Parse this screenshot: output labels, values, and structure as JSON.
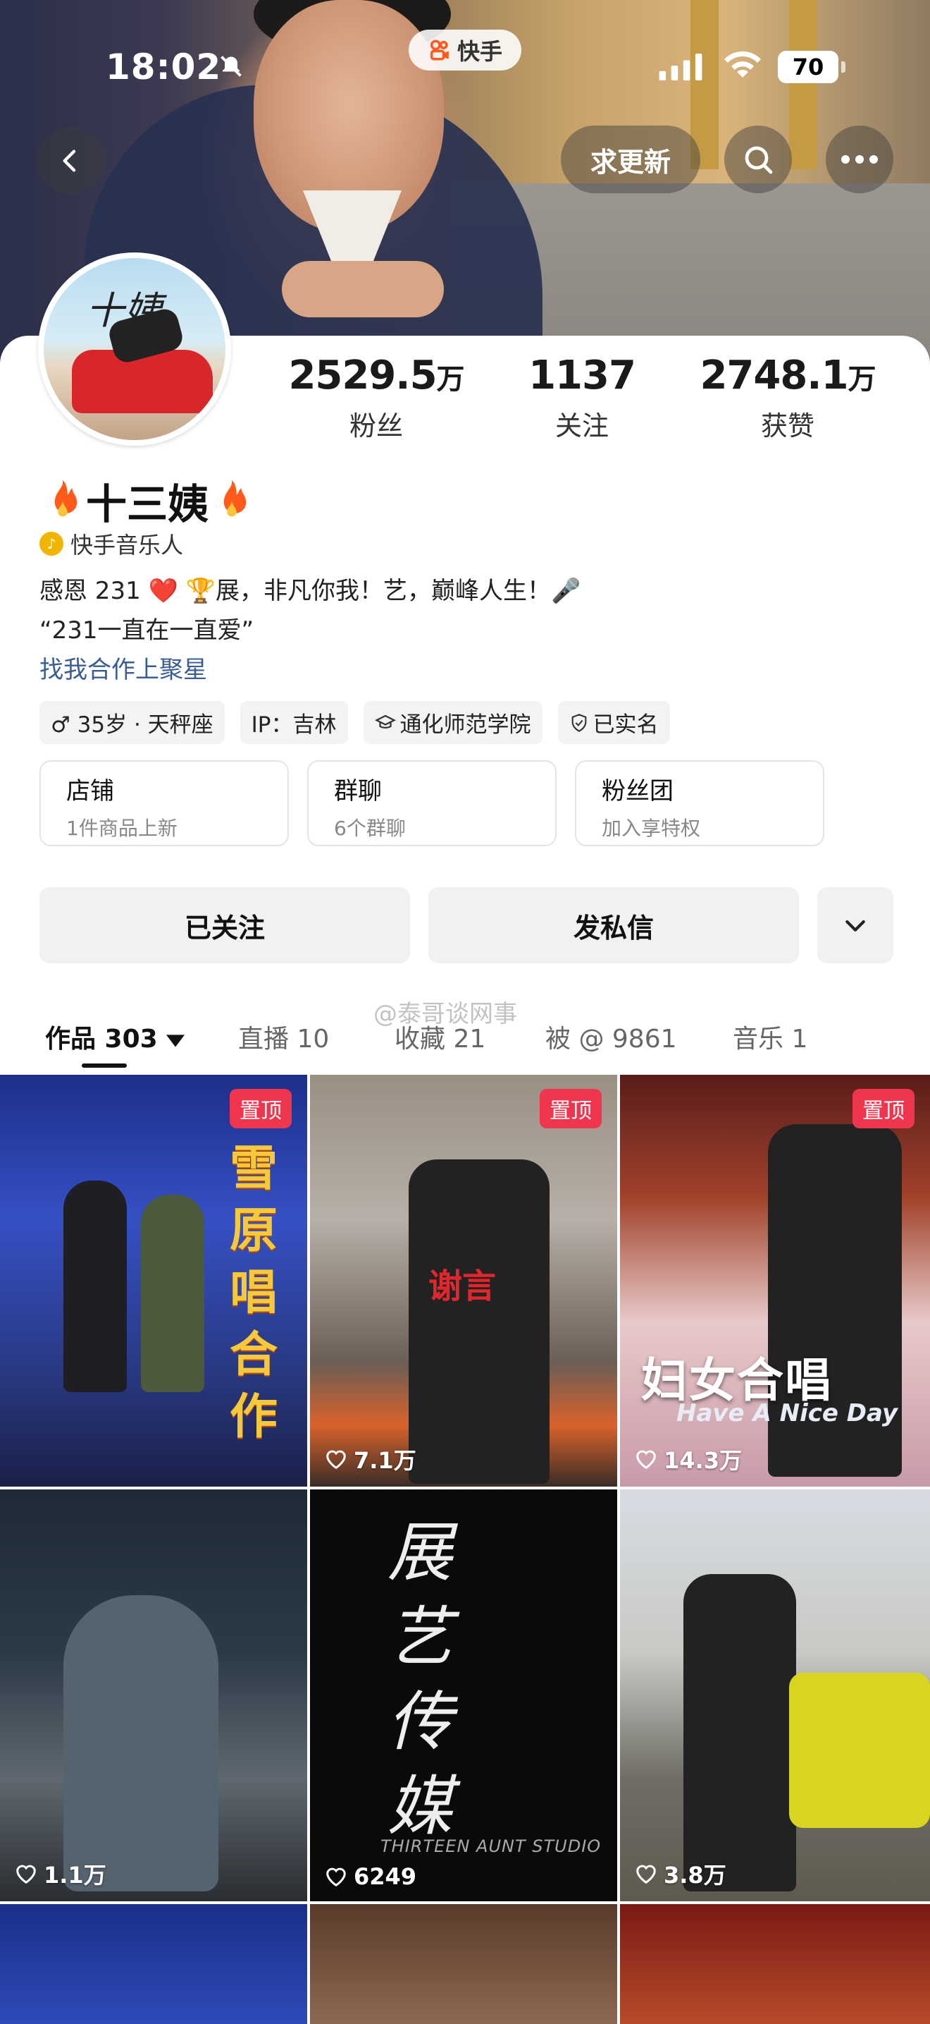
{
  "status_bar": {
    "time": "18:02",
    "app_pill": "快手",
    "battery": "70"
  },
  "nav": {
    "update_label": "求更新"
  },
  "profile": {
    "stats": [
      {
        "num": "2529.5",
        "unit": "万",
        "label": "粉丝"
      },
      {
        "num": "1137",
        "unit": "",
        "label": "关注"
      },
      {
        "num": "2748.1",
        "unit": "万",
        "label": "获赞"
      }
    ],
    "name": "十三姨",
    "badge": "快手音乐人",
    "bio_line1": "感恩 231 ❤️  🏆展，非凡你我！艺，巅峰人生！🎤",
    "bio_line2": "“231一直在一直爱”",
    "bio_link": "找我合作上聚星",
    "chips": [
      "♂ 35岁 · 天秤座",
      "IP：吉林",
      "通化师范学院",
      "已实名"
    ],
    "boxes": [
      {
        "title": "店铺",
        "sub": "1件商品上新"
      },
      {
        "title": "群聊",
        "sub": "6个群聊"
      },
      {
        "title": "粉丝团",
        "sub": "加入享特权"
      }
    ],
    "follow_label": "已关注",
    "message_label": "发私信"
  },
  "tabs": [
    {
      "label": "作品 303",
      "active": true
    },
    {
      "label": "直播 10"
    },
    {
      "label": "收藏 21"
    },
    {
      "label": "被 @ 9861"
    },
    {
      "label": "音乐 1"
    }
  ],
  "watermark": "@泰哥谈网事",
  "grid": {
    "pinned_label": "置顶",
    "items": [
      {
        "likes": "",
        "caption": "雪原唱合作",
        "pinned": true
      },
      {
        "likes": "7.1万",
        "caption": "谢言",
        "pinned": true
      },
      {
        "likes": "14.3万",
        "caption": "妇女合唱",
        "caption2": "Have A Nice Day",
        "pinned": true
      },
      {
        "likes": "1.1万"
      },
      {
        "likes": "6249",
        "caption": "展艺传媒",
        "caption2": "THIRTEEN AUNT STUDIO"
      },
      {
        "likes": "3.8万"
      }
    ]
  }
}
